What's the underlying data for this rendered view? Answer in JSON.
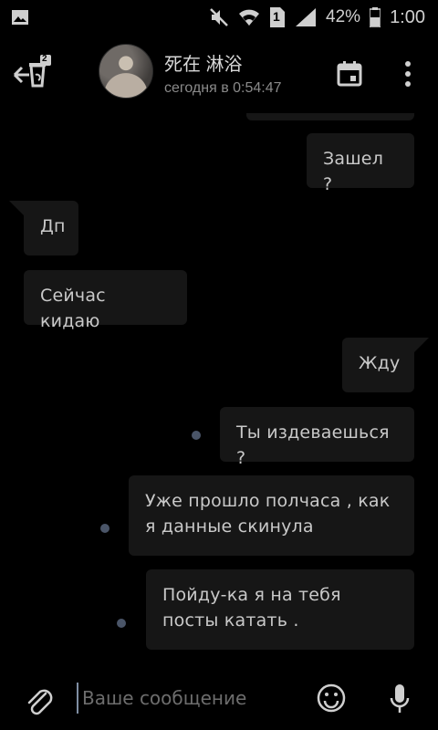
{
  "status_bar": {
    "battery_percent": "42%",
    "time": "1:00",
    "sim_slot": "1",
    "icons": [
      "image-icon",
      "moon-icon",
      "mute-icon",
      "wifi-icon",
      "sim-icon",
      "signal-icon",
      "battery-icon"
    ]
  },
  "header": {
    "contact_name": "死在 淋浴",
    "last_seen": "сегодня в 0:54:47",
    "back_badge": "2",
    "icons": [
      "back-arrow-icon",
      "calendar-icon",
      "more-vert-icon"
    ]
  },
  "messages": [
    {
      "side": "out",
      "text": "Зашел ?"
    },
    {
      "side": "in",
      "text": "Дп"
    },
    {
      "side": "in",
      "text": "Сейчас кидаю"
    },
    {
      "side": "out",
      "text": "Жду"
    },
    {
      "side": "out",
      "text": "Ты издеваешься ?",
      "unread": true
    },
    {
      "side": "out",
      "text": "Уже прошло полчаса , как я данные скинула",
      "unread": true
    },
    {
      "side": "out",
      "text": "Пойду-ка я на тебя посты катать .",
      "unread": true
    }
  ],
  "composer": {
    "placeholder": "Ваше сообщение",
    "value": "",
    "icons": [
      "paperclip-icon",
      "emoji-icon",
      "mic-icon"
    ]
  },
  "colors": {
    "background": "#000000",
    "bubble": "#161616",
    "text": "#c9c9c9",
    "unread_dot": "#4a5568"
  }
}
